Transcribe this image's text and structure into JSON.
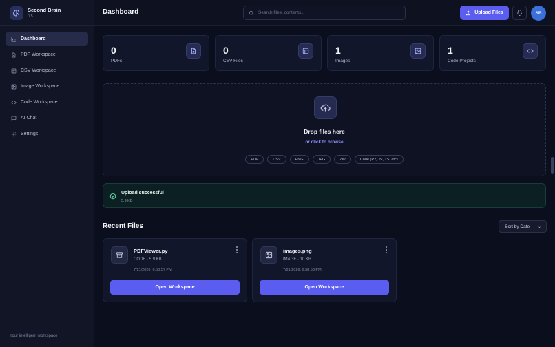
{
  "app": {
    "name": "Second Brain",
    "version": "0.5"
  },
  "sidebar": {
    "items": [
      {
        "label": "Dashboard",
        "icon": "chart-icon",
        "active": true
      },
      {
        "label": "PDF Workspace",
        "icon": "file-text-icon"
      },
      {
        "label": "CSV Workspace",
        "icon": "table-icon"
      },
      {
        "label": "Image Workspace",
        "icon": "image-icon"
      },
      {
        "label": "Code Workspace",
        "icon": "code-icon"
      },
      {
        "label": "AI Chat",
        "icon": "chat-icon"
      },
      {
        "label": "Settings",
        "icon": "gear-icon"
      }
    ],
    "footer": "Your intelligent workspace"
  },
  "header": {
    "title": "Dashboard",
    "search_placeholder": "Search files, contents...",
    "upload_label": "Upload Files",
    "avatar_initials": "SB"
  },
  "stats": [
    {
      "count": "0",
      "label": "PDFs",
      "icon": "file-text-icon"
    },
    {
      "count": "0",
      "label": "CSV Files",
      "icon": "table-icon"
    },
    {
      "count": "1",
      "label": "Images",
      "icon": "image-icon"
    },
    {
      "count": "1",
      "label": "Code Projects",
      "icon": "code-icon"
    }
  ],
  "dropzone": {
    "title": "Drop files here",
    "subtitle": "or click to browse",
    "types": [
      "PDF",
      "CSV",
      "PNG",
      "JPG",
      "ZIP",
      "Code (PY, JS, TS, etc)"
    ]
  },
  "toast": {
    "title": "Upload successful",
    "detail": "5.9 KB"
  },
  "recent": {
    "title": "Recent Files",
    "sort_label": "Sort by Date",
    "files": [
      {
        "name": "PDFViewer.py",
        "meta": "CODE · 5.9 KB",
        "date": "7/21/2026, 6:58:57 PM",
        "button": "Open Workspace",
        "icon": "archive-icon"
      },
      {
        "name": "images.png",
        "meta": "IMAGE · 10 KB",
        "date": "7/21/2026, 6:58:53 PM",
        "button": "Open Workspace",
        "icon": "image-icon"
      }
    ]
  },
  "colors": {
    "accent": "#5b5cf0",
    "background": "#0b0e1c",
    "sidebar": "#111526",
    "success": "#5fd3a0"
  }
}
